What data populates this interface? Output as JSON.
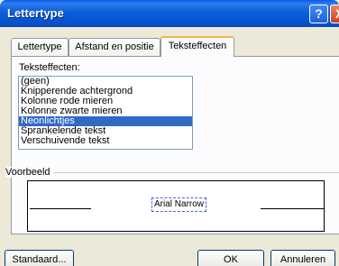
{
  "window": {
    "title": "Lettertype",
    "help": "?",
    "close": "X"
  },
  "tabs": [
    {
      "label": "Lettertype"
    },
    {
      "label": "Afstand en positie"
    },
    {
      "label": "Teksteffecten"
    }
  ],
  "effects": {
    "label": "Teksteffecten:",
    "items": [
      {
        "label": "(geen)"
      },
      {
        "label": "Knipperende achtergrond"
      },
      {
        "label": "Kolonne rode mieren"
      },
      {
        "label": "Kolonne zwarte mieren"
      },
      {
        "label": "Neonlichtjes"
      },
      {
        "label": "Sprankelende tekst"
      },
      {
        "label": "Verschuivende tekst"
      }
    ],
    "selected": "Neonlichtjes"
  },
  "preview": {
    "label": "Voorbeeld",
    "sample": "Arial Narrow"
  },
  "buttons": {
    "default": "Standaard...",
    "ok": "OK",
    "cancel": "Annuleren"
  }
}
